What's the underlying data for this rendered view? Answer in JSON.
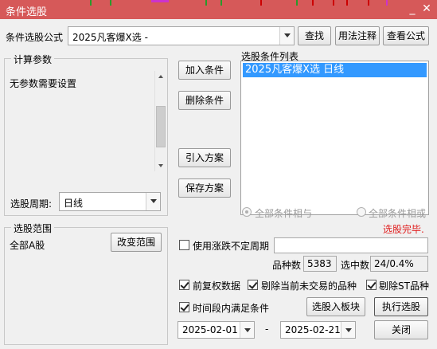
{
  "window": {
    "title": "条件选股",
    "minimize_glyph": "_",
    "close_glyph": "✕",
    "accent_color": "#d65959"
  },
  "formula": {
    "label": "条件选股公式",
    "value": "2025凡客爆X选 -"
  },
  "buttons": {
    "find": "查找",
    "usage_notes": "用法注释",
    "view_formula": "查看公式",
    "add_condition": "加入条件",
    "delete_condition": "删除条件",
    "import_plan": "引入方案",
    "save_plan": "保存方案",
    "change_range": "改变范围",
    "select_to_board": "选股入板块",
    "execute": "执行选股",
    "close": "关闭"
  },
  "params": {
    "group_title": "计算参数",
    "message": "无参数需要设置",
    "period_label": "选股周期:",
    "period_value": "日线"
  },
  "conditions": {
    "title": "选股条件列表",
    "items": [
      "2025凡客爆X选  日线"
    ]
  },
  "logic": {
    "and_label": "全部条件相与",
    "or_label": "全部条件相或"
  },
  "status": {
    "text": "选股完毕.",
    "color": "#e02020"
  },
  "range": {
    "group_title": "选股范围",
    "value": "全部A股"
  },
  "uncertain_period": {
    "label": "使用涨跌不定周期",
    "value": ""
  },
  "counts": {
    "total_label": "品种数",
    "total_value": "5383",
    "selected_label": "选中数",
    "selected_value": "24/0.4%"
  },
  "options": {
    "forward_adjust": "前复权数据",
    "exclude_untraded": "剔除当前未交易的品种",
    "exclude_st": "剔除ST品种",
    "period_satisfy": "时间段内满足条件"
  },
  "dates": {
    "start": "2025-02-01",
    "separator": "-",
    "end": "2025-02-21"
  }
}
